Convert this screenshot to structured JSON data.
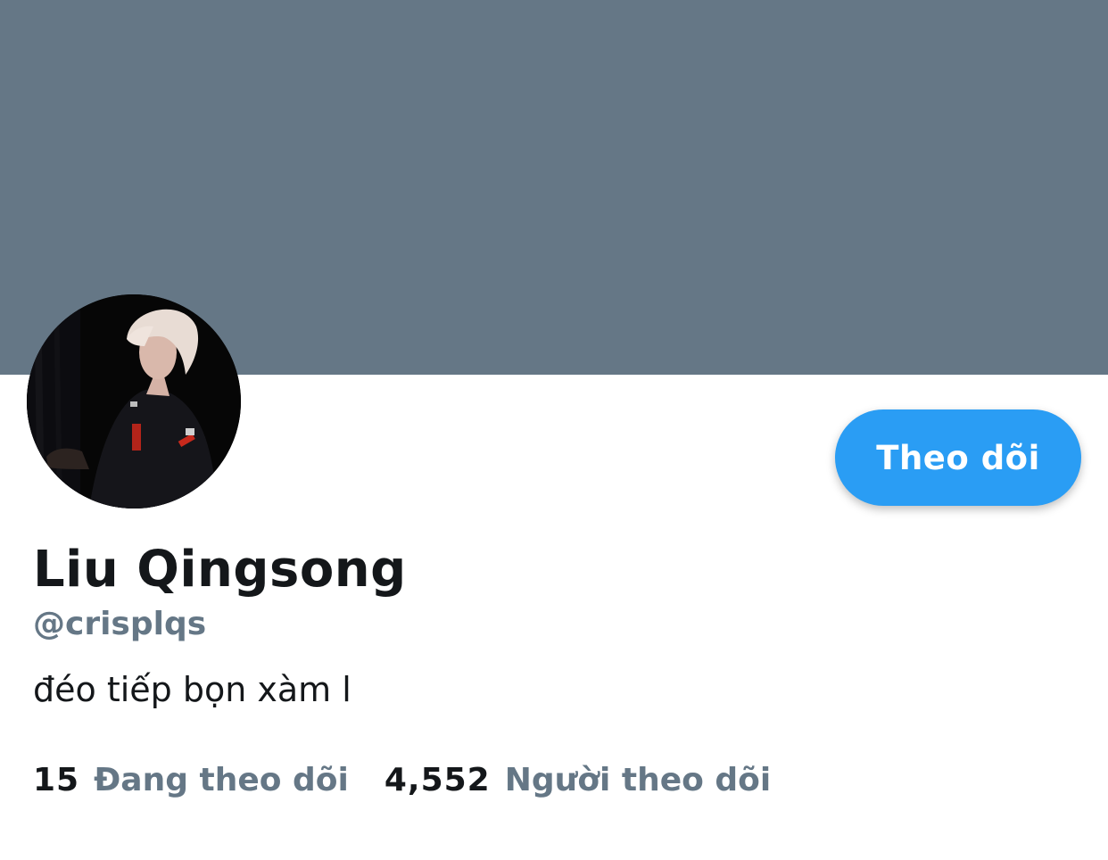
{
  "colors": {
    "banner": "#657786",
    "primary_text": "#14171a",
    "secondary_text": "#657786",
    "accent": "#2a9df4",
    "button_text": "#ffffff"
  },
  "profile": {
    "display_name": "Liu Qingsong",
    "handle": "@crisplqs",
    "bio": "đéo tiếp bọn xàm l"
  },
  "actions": {
    "follow_label": "Theo dõi"
  },
  "stats": {
    "following_count": "15",
    "following_label": "Đang theo dõi",
    "followers_count": "4,552",
    "followers_label": "Người theo dõi"
  }
}
